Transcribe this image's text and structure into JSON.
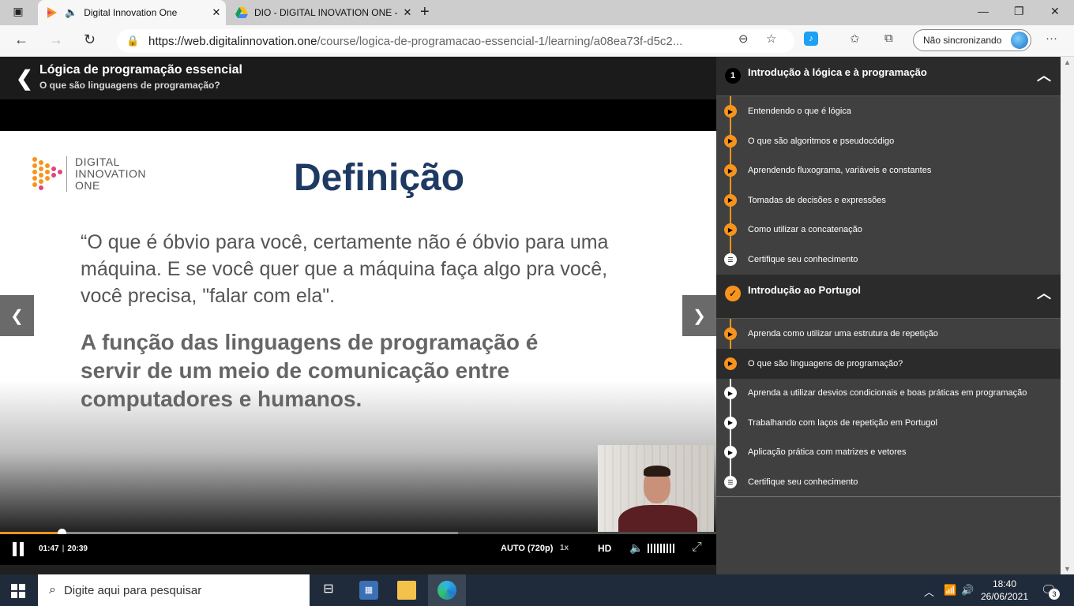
{
  "browser": {
    "tabs": [
      {
        "title": "Digital Innovation One",
        "active": true,
        "audio_icon": "speaker-icon"
      },
      {
        "title": "DIO - DIGITAL INOVATION ONE -",
        "active": false
      }
    ],
    "url_main": "https://web.digitalinnovation.one",
    "url_rest": "/course/logica-de-programacao-essencial-1/learning/a08ea73f-d5c2...",
    "sync_label": "Não sincronizando"
  },
  "course": {
    "title": "Lógica de programação essencial",
    "lesson": "O que são linguagens de programação?"
  },
  "slide": {
    "logo_lines": [
      "DIGITAL",
      "INNOVATION",
      "ONE"
    ],
    "heading": "Definição",
    "quote": "“O que é óbvio para você, certamente não é óbvio para uma máquina. E se você quer que a máquina faça algo pra você, você precisa, \"falar com ela\".",
    "statement": "A função das linguagens de programação é servir de um meio de comunicação entre computadores e humanos."
  },
  "player": {
    "current_time": "01:47",
    "duration": "20:39",
    "played_fraction": 0.0864,
    "buffered_fraction": 0.64,
    "quality": "AUTO (720p)",
    "speed": "1x",
    "hd_label": "HD"
  },
  "sidebar": {
    "sections": [
      {
        "number": "1",
        "title": "Introdução à lógica e à programação",
        "lessons": [
          {
            "title": "Entendendo o que é lógica",
            "status": "play-orange"
          },
          {
            "title": "O que são algoritmos e pseudocódigo",
            "status": "play-orange"
          },
          {
            "title": "Aprendendo fluxograma, variáveis e constantes",
            "status": "play-orange"
          },
          {
            "title": "Tomadas de decisões e expressões",
            "status": "play-orange"
          },
          {
            "title": "Como utilizar a concatenação",
            "status": "play-orange"
          },
          {
            "title": "Certifique seu conhecimento",
            "status": "quiz-white"
          }
        ]
      },
      {
        "number": "",
        "title": "Introdução ao Portugol",
        "lessons": [
          {
            "title": "Aprenda como utilizar uma estrutura de repetição",
            "status": "play-orange"
          },
          {
            "title": "O que são linguagens de programação?",
            "status": "play-orange",
            "current": true
          },
          {
            "title": "Aprenda a utilizar desvios condicionais e boas práticas em programação",
            "status": "play-white"
          },
          {
            "title": "Trabalhando com laços de repetição em Portugol",
            "status": "play-white"
          },
          {
            "title": "Aplicação prática com matrizes e vetores",
            "status": "play-white"
          },
          {
            "title": "Certifique seu conhecimento",
            "status": "quiz-white"
          }
        ]
      }
    ]
  },
  "taskbar": {
    "search_placeholder": "Digite aqui para pesquisar",
    "time": "18:40",
    "date": "26/06/2021",
    "notifications": "3"
  },
  "colors": {
    "accent": "#f7941d",
    "slide_heading": "#1e3a63",
    "sidebar_bg": "#404040"
  }
}
